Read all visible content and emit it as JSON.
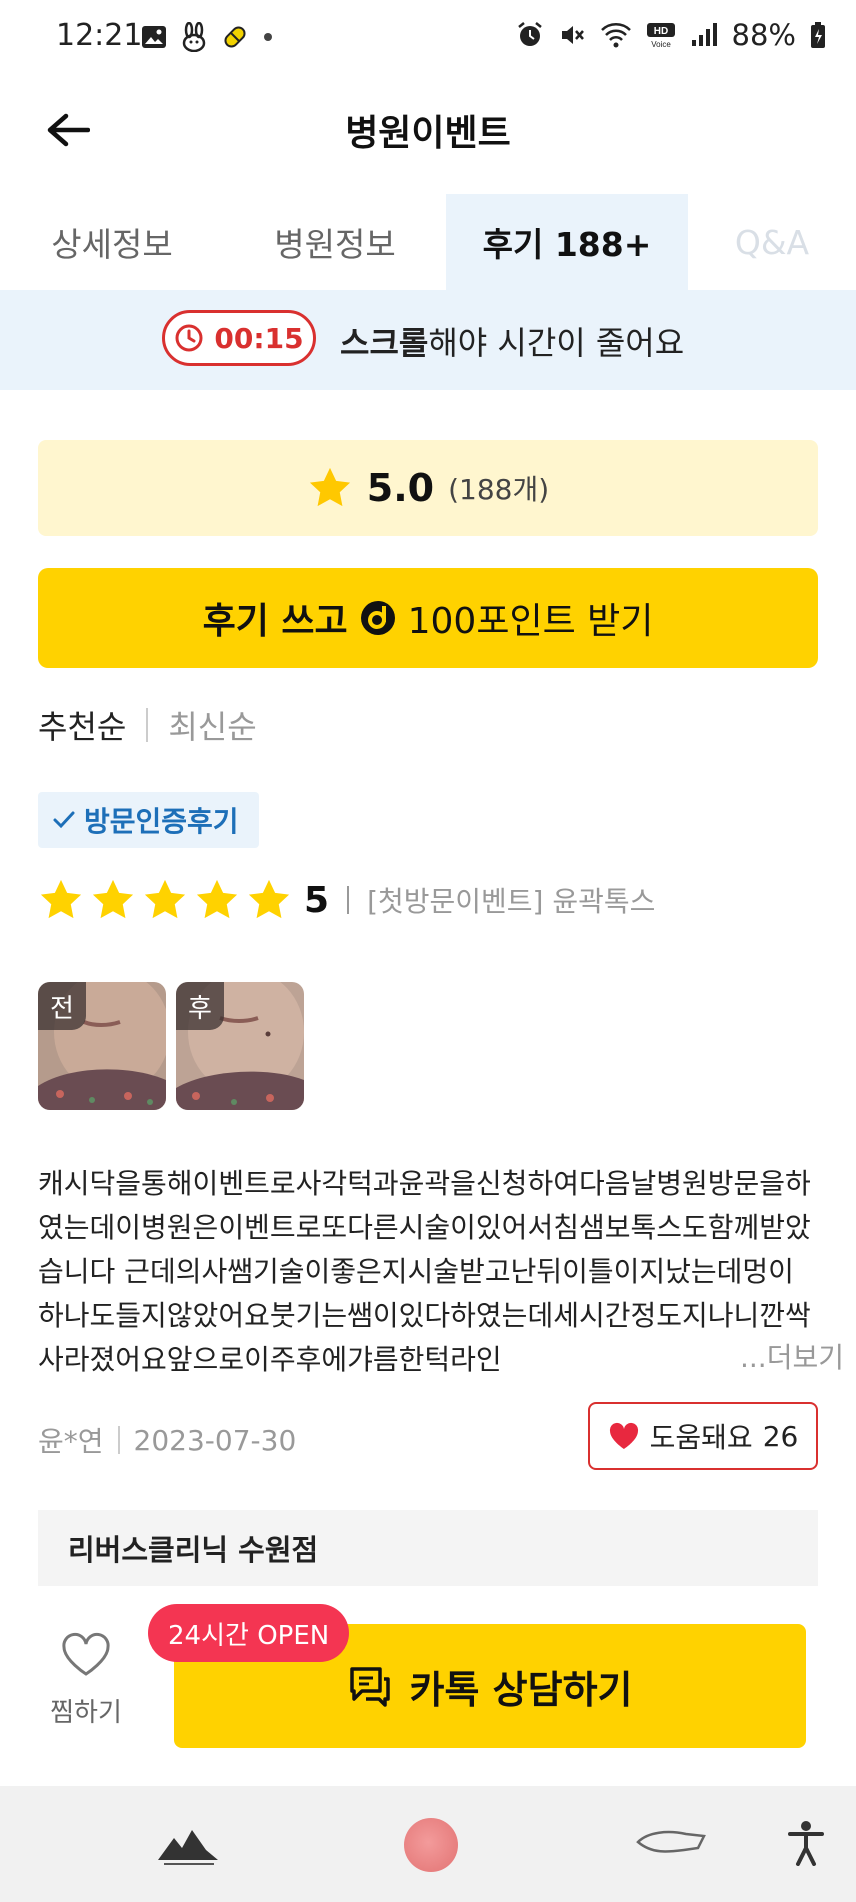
{
  "status_bar": {
    "time": "12:21",
    "battery": "88%"
  },
  "header": {
    "title": "병원이벤트"
  },
  "tabs": [
    {
      "label": "상세정보",
      "active": false
    },
    {
      "label": "병원정보",
      "active": false
    },
    {
      "label": "후기 188+",
      "active": true
    },
    {
      "label": "Q&A",
      "active": false
    }
  ],
  "timer": {
    "time": "00:15",
    "message_bold": "스크롤",
    "message_rest": "해야 시간이 줄어요"
  },
  "rating": {
    "score": "5.0",
    "count": "(188개)"
  },
  "write_review": {
    "label_prefix": "후기 쓰고",
    "label_suffix": "100포인트 받기"
  },
  "sort": {
    "options": [
      "추천순",
      "최신순"
    ],
    "active": "추천순"
  },
  "review": {
    "badge": "방문인증후기",
    "stars": 5,
    "score": "5",
    "item": "[첫방문이벤트] 윤곽톡스",
    "photos": [
      {
        "label": "전"
      },
      {
        "label": "후"
      }
    ],
    "text": "캐시닥을통해이벤트로사각턱과윤곽을신청하여다음날병원방문을하였는데이병원은이벤트로또다른시술이있어서침샘보톡스도함께받았습니다 근데의사쌤기술이좋은지시술받고난뒤이틀이지났는데멍이하나도들지않았어요붓기는쌤이있다하였는데세시간정도지나니깐싹사라졌어요앞으로이주후에갸름한턱라인",
    "more": "...더보기",
    "author": "윤*연",
    "date": "2023-07-30",
    "helpful_label": "도움돼요",
    "helpful_count": "26"
  },
  "clinic": {
    "name": "리버스클리닉 수원점"
  },
  "bottom_bar": {
    "favorite_label": "찜하기",
    "badge": "24시간 OPEN",
    "kakao_label": "카톡 상담하기"
  },
  "colors": {
    "accent_yellow": "#ffd200",
    "accent_red": "#d9302f",
    "tab_active_bg": "#eaf3fb",
    "badge_blue": "#1d6fb8",
    "open_badge": "#f43552"
  }
}
